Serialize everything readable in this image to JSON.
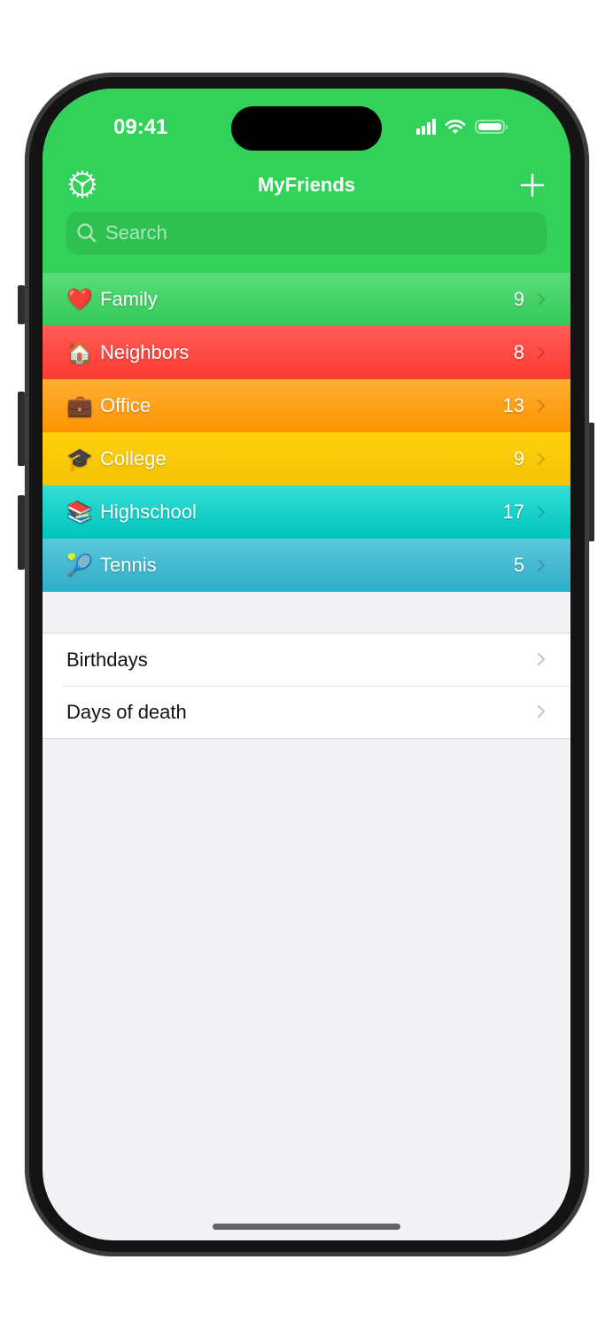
{
  "status_bar": {
    "time": "09:41",
    "icons": [
      "cellular-signal-icon",
      "wifi-icon",
      "battery-icon"
    ]
  },
  "nav": {
    "title": "MyFriends",
    "left_icon": "gear-icon",
    "right_icon": "plus-icon"
  },
  "search": {
    "placeholder": "Search",
    "value": ""
  },
  "groups": [
    {
      "emoji": "❤️",
      "label": "Family",
      "count": "9",
      "color_top": "#5bdc7a",
      "color_bottom": "#32c957"
    },
    {
      "emoji": "🏠",
      "label": "Neighbors",
      "count": "8",
      "color_top": "#ff5c58",
      "color_bottom": "#fe3a30"
    },
    {
      "emoji": "💼",
      "label": "Office",
      "count": "13",
      "color_top": "#ffae33",
      "color_bottom": "#ff9400"
    },
    {
      "emoji": "🎓",
      "label": "College",
      "count": "9",
      "color_top": "#ffd00c",
      "color_bottom": "#f3c304"
    },
    {
      "emoji": "📚",
      "label": "Highschool",
      "count": "17",
      "color_top": "#33dfd6",
      "color_bottom": "#00c4bb"
    },
    {
      "emoji": "🎾",
      "label": "Tennis",
      "count": "5",
      "color_top": "#5ac8dc",
      "color_bottom": "#30adc6"
    }
  ],
  "lists": [
    {
      "label": "Birthdays"
    },
    {
      "label": "Days of death"
    }
  ],
  "colors": {
    "header": "#32d25a",
    "background": "#f2f2f7"
  }
}
